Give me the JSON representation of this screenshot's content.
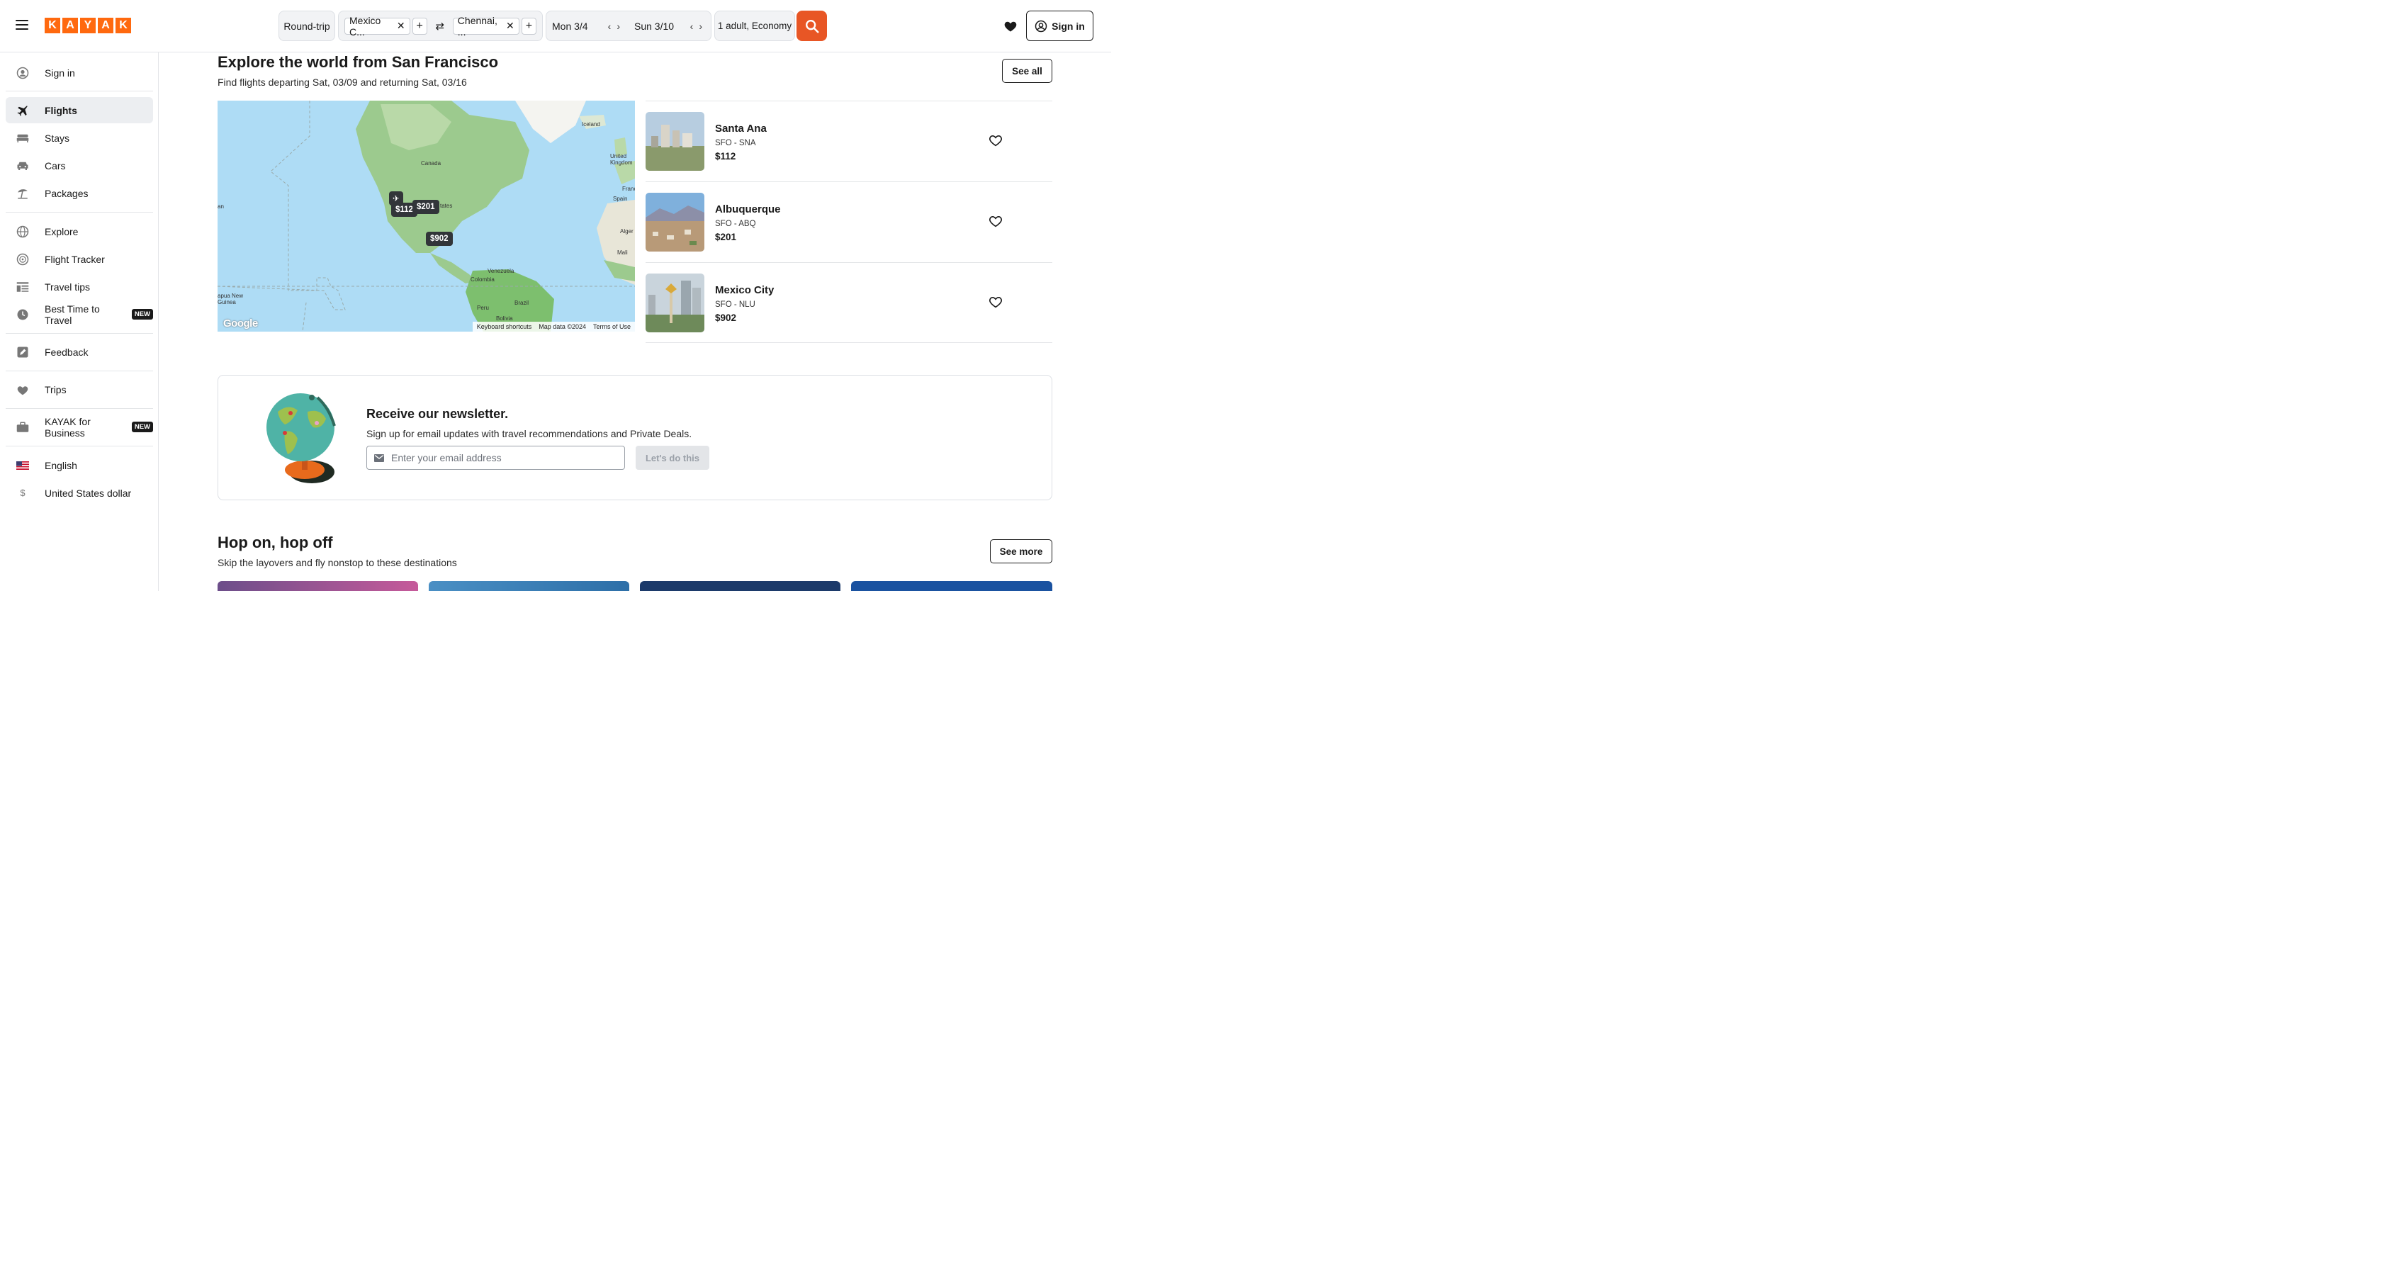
{
  "brand": {
    "logo_letters": [
      "K",
      "A",
      "Y",
      "A",
      "K"
    ],
    "accent": "#ff690f",
    "search_color": "#e85625"
  },
  "search": {
    "trip_type": "Round-trip",
    "origin": "Mexico C...",
    "destination": "Chennai, ...",
    "depart": "Mon 3/4",
    "return": "Sun 3/10",
    "travelers": "1 adult, Economy"
  },
  "header": {
    "sign_in": "Sign in"
  },
  "sidebar": {
    "items": [
      {
        "label": "Sign in",
        "icon": "user-circle-icon"
      },
      {
        "label": "Flights",
        "icon": "plane-icon"
      },
      {
        "label": "Stays",
        "icon": "bed-icon"
      },
      {
        "label": "Cars",
        "icon": "car-icon"
      },
      {
        "label": "Packages",
        "icon": "beach-umbrella-icon"
      },
      {
        "label": "Explore",
        "icon": "globe-icon"
      },
      {
        "label": "Flight Tracker",
        "icon": "radar-icon"
      },
      {
        "label": "Travel tips",
        "icon": "list-icon"
      },
      {
        "label": "Best Time to Travel",
        "icon": "clock-icon",
        "badge": "NEW"
      },
      {
        "label": "Feedback",
        "icon": "edit-icon"
      },
      {
        "label": "Trips",
        "icon": "heart-icon"
      },
      {
        "label": "KAYAK for Business",
        "icon": "briefcase-icon",
        "badge": "NEW"
      },
      {
        "label": "English",
        "icon": "us-flag-icon"
      },
      {
        "label": "United States dollar",
        "icon": "dollar-icon"
      }
    ]
  },
  "explore": {
    "title": "Explore the world from San Francisco",
    "subtitle": "Find flights departing Sat, 03/09 and returning Sat, 03/16",
    "see_all": "See all",
    "map": {
      "pins": [
        "$112",
        "$201",
        "$902"
      ],
      "labels": [
        "Iceland",
        "United Kingdom",
        "Canada",
        "Spain",
        "Alger",
        "Mali",
        "Venezuela",
        "Colombia",
        "Peru",
        "Brazil",
        "Bolivia",
        "apua New Guinea",
        "Franc",
        "tates",
        "an"
      ],
      "footer": [
        "Keyboard shortcuts",
        "Map data ©2024",
        "Terms of Use"
      ],
      "provider": "Google"
    },
    "destinations": [
      {
        "city": "Santa Ana",
        "route": "SFO - SNA",
        "price": "$112"
      },
      {
        "city": "Albuquerque",
        "route": "SFO - ABQ",
        "price": "$201"
      },
      {
        "city": "Mexico City",
        "route": "SFO - NLU",
        "price": "$902"
      }
    ]
  },
  "newsletter": {
    "title": "Receive our newsletter.",
    "subtitle": "Sign up for email updates with travel recommendations and Private Deals.",
    "placeholder": "Enter your email address",
    "button": "Let's do this"
  },
  "hop": {
    "title": "Hop on, hop off",
    "subtitle": "Skip the layovers and fly nonstop to these destinations",
    "see_more": "See more"
  }
}
